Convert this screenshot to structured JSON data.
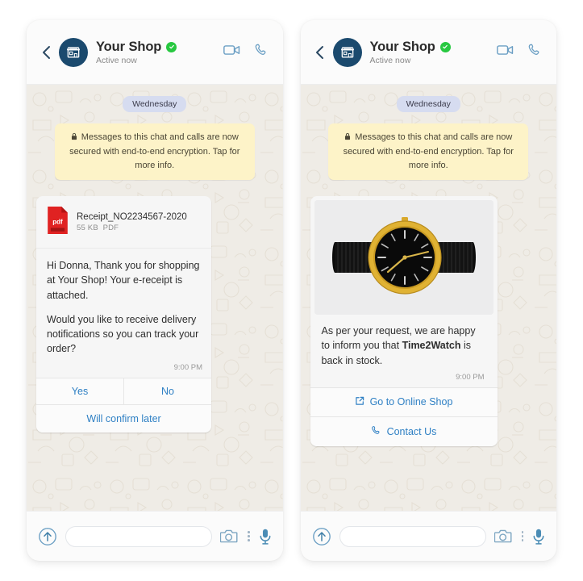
{
  "header": {
    "shop_name": "Your Shop",
    "status": "Active now",
    "verified": true,
    "back_icon": "back-chevron-icon",
    "video_icon": "video-call-icon",
    "call_icon": "voice-call-icon",
    "avatar_icon": "storefront-icon"
  },
  "chat": {
    "day_label": "Wednesday",
    "encryption_notice": "Messages to this chat and calls are now secured with end-to-end encryption. Tap for more info."
  },
  "left_panel": {
    "attachment": {
      "file_name": "Receipt_NO2234567-2020",
      "file_size": "55 KB",
      "file_type": "PDF",
      "icon_label": "pdf"
    },
    "message_paragraph_1": "Hi Donna, Thank you for shopping at Your Shop! Your e-receipt is attached.",
    "message_paragraph_2": "Would you like to receive delivery notifications so you can track your order?",
    "timestamp": "9:00 PM",
    "buttons": {
      "yes": "Yes",
      "no": "No",
      "later": "Will confirm later"
    }
  },
  "right_panel": {
    "product_alt": "gold-watch-black-dial-photo",
    "message_prefix": "As per your request, we are happy to inform you that ",
    "brand": "Time2Watch",
    "message_suffix": " is back in stock.",
    "timestamp": "9:00 PM",
    "buttons": {
      "shop": "Go to Online Shop",
      "contact": "Contact Us"
    }
  },
  "composer": {
    "input_value": "",
    "input_placeholder": "",
    "send_icon": "arrow-up-circle-icon",
    "camera_icon": "camera-icon",
    "more_icon": "more-vertical-icon",
    "mic_icon": "microphone-icon"
  },
  "colors": {
    "accent_blue": "#2f80c4",
    "verified_green": "#27c840",
    "encryption_yellow": "#fdf3c8",
    "day_chip": "#d6dcf0",
    "avatar_navy": "#1b4a6e",
    "pdf_red": "#e02222"
  }
}
